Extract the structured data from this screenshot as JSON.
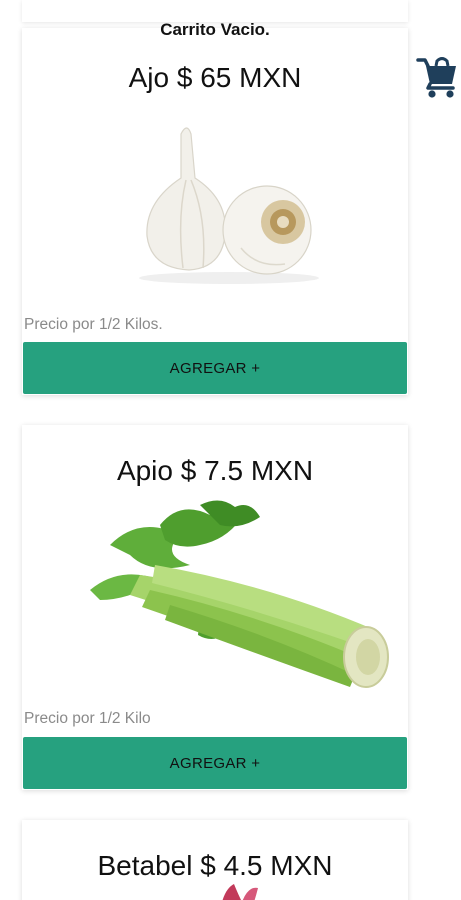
{
  "cart": {
    "status": "Carrito Vacio.",
    "icon": "shopping-cart-icon",
    "icon_color": "#1f3f5b"
  },
  "accent_color": "#26a17f",
  "products": [
    {
      "title": "Ajo $ 65 MXN",
      "image": "garlic-image",
      "unit": "Precio por 1/2 Kilos.",
      "button": "AGREGAR +"
    },
    {
      "title": "Apio $ 7.5 MXN",
      "image": "celery-image",
      "unit": "Precio por 1/2 Kilo",
      "button": "AGREGAR +"
    },
    {
      "title": "Betabel $ 4.5 MXN",
      "image": "beet-image"
    }
  ]
}
